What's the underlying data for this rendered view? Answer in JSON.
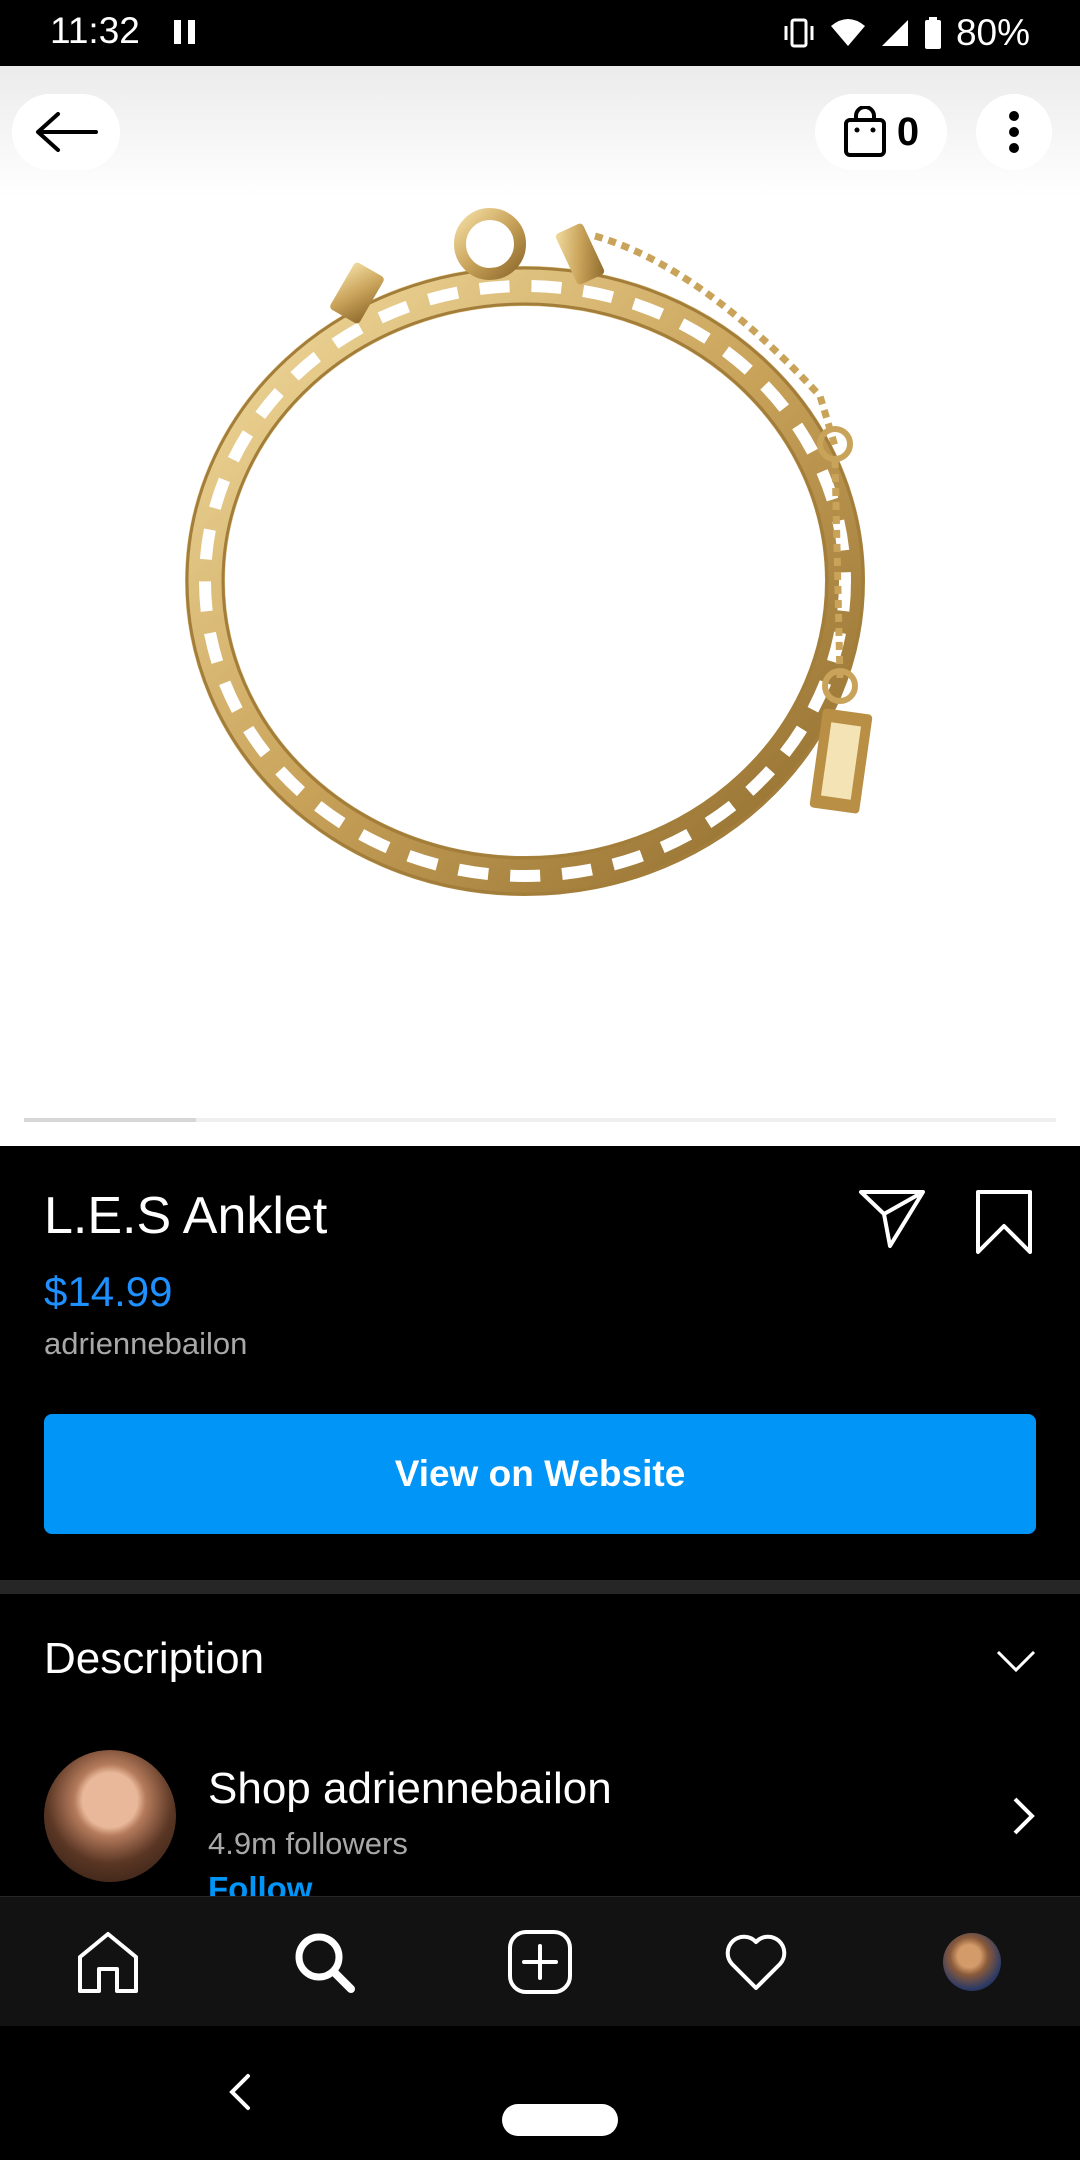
{
  "status_bar": {
    "time": "11:32",
    "battery": "80%"
  },
  "top_bar": {
    "cart_count": "0"
  },
  "gallery": {
    "image_index": 1,
    "image_count": 6
  },
  "product": {
    "title": "L.E.S Anklet",
    "price": "$14.99",
    "seller": "adriennebailon",
    "cta_label": "View on Website"
  },
  "description": {
    "label": "Description"
  },
  "shop": {
    "name": "Shop adriennebailon",
    "followers": "4.9m followers",
    "follow_label": "Follow"
  },
  "colors": {
    "accent": "#0095f6",
    "price": "#1e90ff",
    "secondary_text": "#a8a8a8",
    "background": "#000000"
  },
  "icons": {
    "back": "arrow-left-icon",
    "cart": "shopping-bag-icon",
    "more": "more-vertical-icon",
    "share": "paper-plane-icon",
    "save": "bookmark-icon",
    "expand": "chevron-down-icon",
    "shop_open": "chevron-right-icon",
    "nav": [
      "home-icon",
      "search-icon",
      "add-post-icon",
      "heart-icon",
      "profile-avatar"
    ]
  }
}
